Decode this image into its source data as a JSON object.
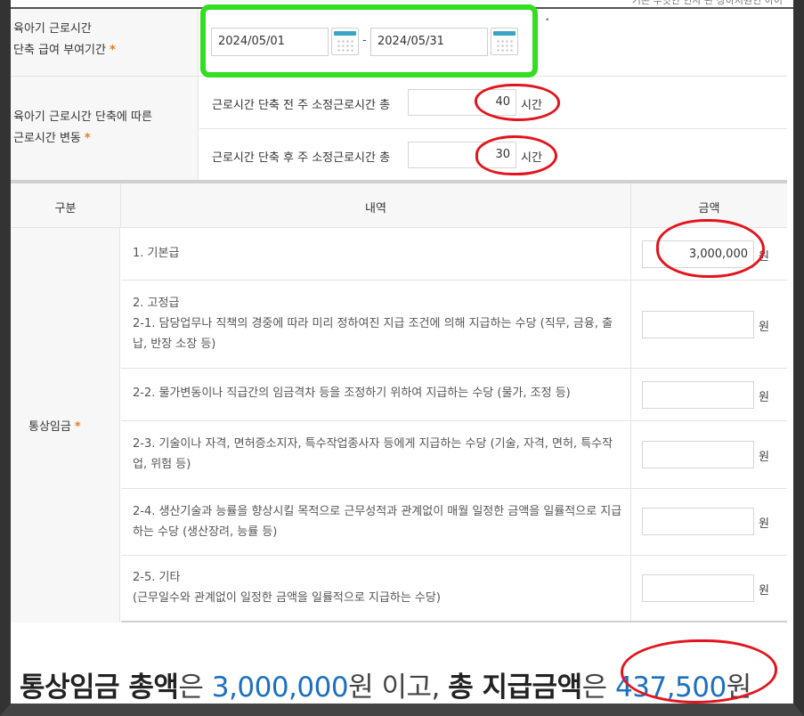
{
  "page": {
    "top_cut_text": "기존 무엇인 인사 관 상하지원인 아이"
  },
  "period": {
    "label_line1": "육아기 근로시간",
    "label_line2": "단축 급여 부여기간",
    "star": "*",
    "start_date": "2024/05/01",
    "separator": "-",
    "end_date": "2024/05/31",
    "note_mark": "•"
  },
  "hours": {
    "label_line1": "육아기 근로시간 단축에 따른",
    "label_line2": "근로시간 변동",
    "star": "*",
    "before_label": "근로시간 단축 전 주 소정근로시간 총",
    "before_value": "40",
    "after_label": "근로시간 단축 후 주 소정근로시간 총",
    "after_value": "30",
    "unit": "시간"
  },
  "table": {
    "col_category": "구분",
    "col_detail": "내역",
    "col_amount": "금액",
    "category_label": "통상임금",
    "star": "*",
    "currency": "원",
    "items": [
      {
        "text": "1. 기본급",
        "value": "3,000,000"
      },
      {
        "text": "2. 고정급\n2-1. 담당업무나 직책의 경중에 따라 미리 정하여진 지급 조건에 의해 지급하는 수당 (직무, 금융, 출납, 반장 소장 등)",
        "value": ""
      },
      {
        "text": "2-2. 물가변동이나 직급간의 임금격차 등을 조정하기 위하여 지급하는 수당 (물가, 조정 등)",
        "value": ""
      },
      {
        "text": "2-3. 기술이나 자격, 면허증소지자, 특수작업종사자 등에게 지급하는 수당 (기술, 자격, 면허, 특수작업, 위험 등)",
        "value": ""
      },
      {
        "text": "2-4. 생산기술과 능률을 향상시킬 목적으로 근무성적과 관계없이 매월 일정한 금액을 일률적으로 지급하는 수당 (생산장려, 능률 등)",
        "value": ""
      },
      {
        "text": "2-5. 기타\n(근무일수와 관계없이 일정한 금액을 일률적으로 지급하는 수당)",
        "value": ""
      }
    ]
  },
  "summary": {
    "part1_bold": "통상임금 총액",
    "part2": "은 ",
    "total_wage": "3,000,000",
    "part3": "원 이고, ",
    "part4_bold": "총 지급금액",
    "part5": "은 ",
    "total_payment": "437,500",
    "part6": "원"
  },
  "colors": {
    "highlight_green": "#33dd22",
    "highlight_red": "#e3141e",
    "accent_blue": "#1c6fc1",
    "star_orange": "#f07a1a"
  }
}
